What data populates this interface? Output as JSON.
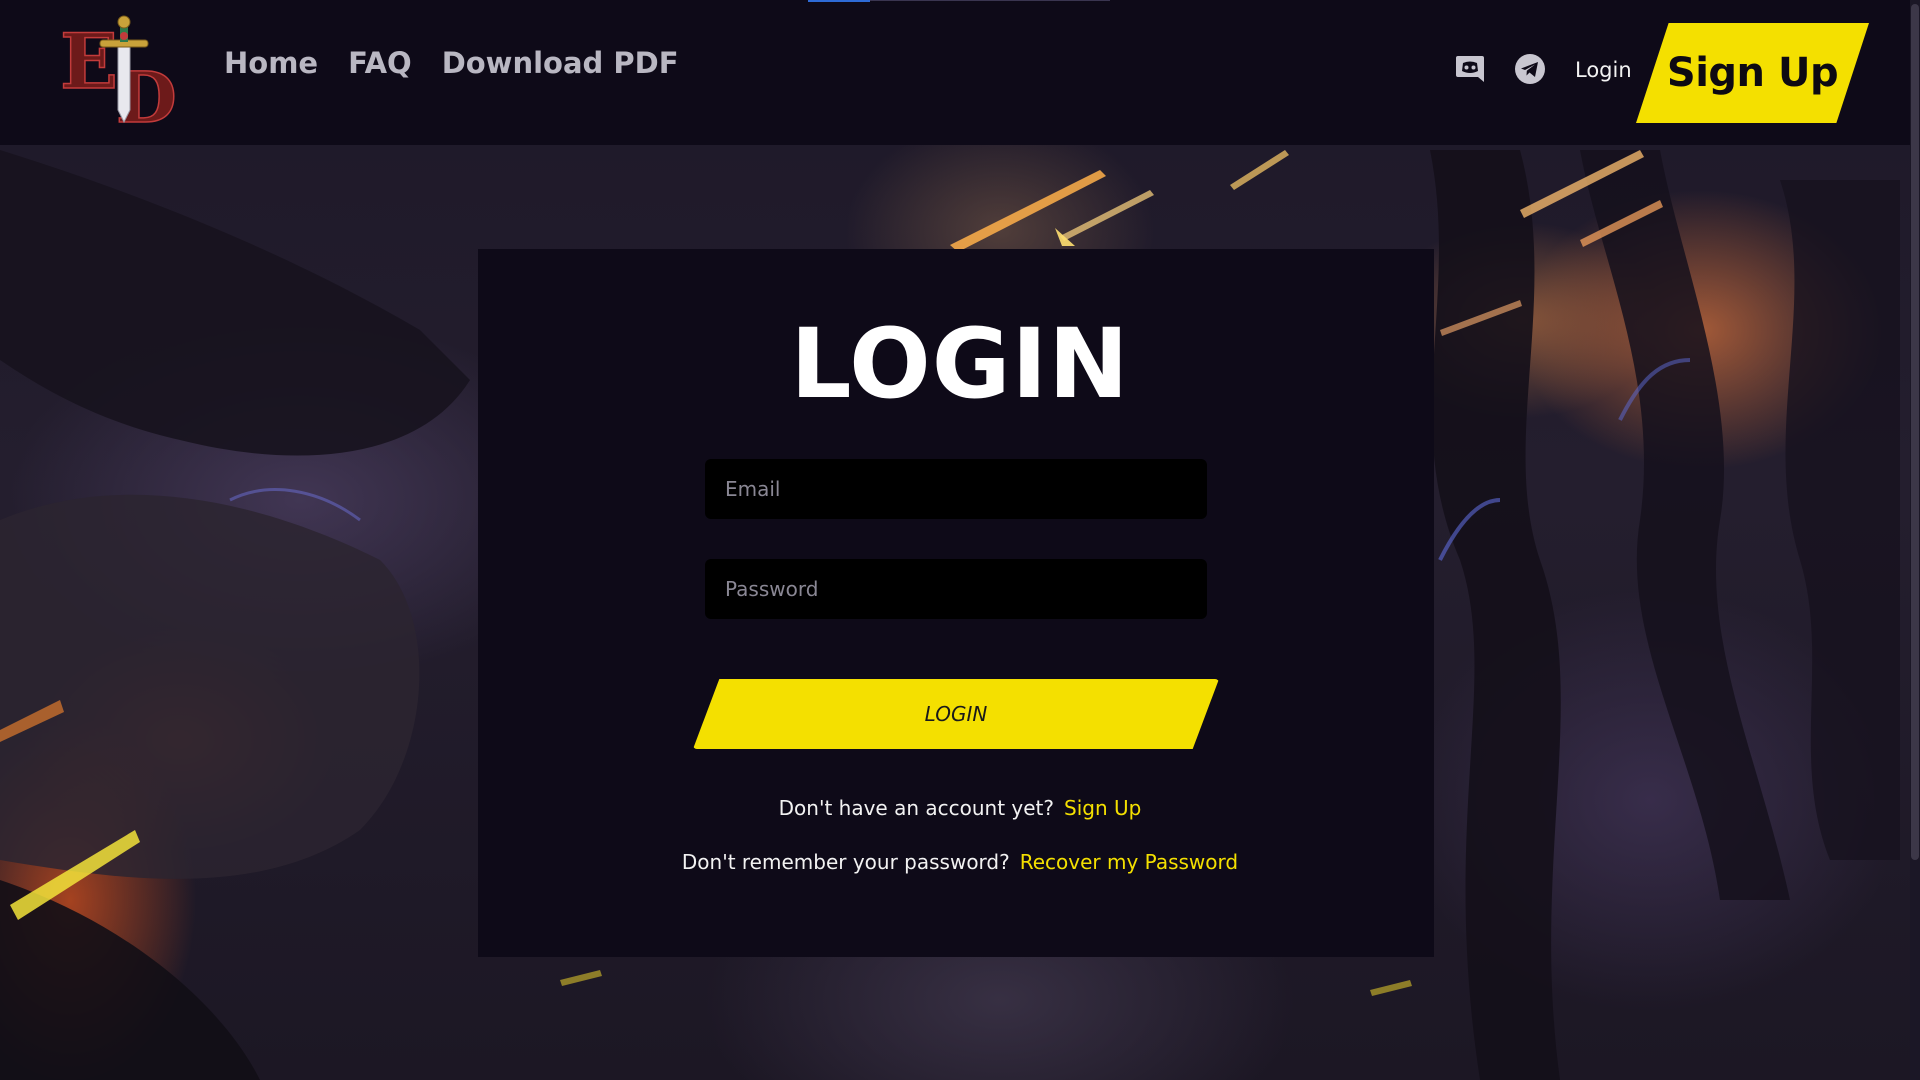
{
  "nav": {
    "items": [
      {
        "label": "Home"
      },
      {
        "label": "FAQ"
      },
      {
        "label": "Download PDF"
      }
    ]
  },
  "header": {
    "login_label": "Login",
    "signup_label": "Sign Up",
    "social_icons": [
      "discord-icon",
      "telegram-icon"
    ]
  },
  "login_card": {
    "title": "LOGIN",
    "email_placeholder": "Email",
    "password_placeholder": "Password",
    "submit_label": "LOGIN",
    "no_account_text": "Don't have an account yet?",
    "signup_link": "Sign Up",
    "forgot_text": "Don't remember your password?",
    "recover_link": "Recover my Password"
  },
  "colors": {
    "accent": "#f4e000",
    "header_bg": "#0e0a18",
    "card_bg": "#0e0a18",
    "input_bg": "#000000",
    "text": "#ffffff",
    "nav_text": "#b9b7c2"
  }
}
